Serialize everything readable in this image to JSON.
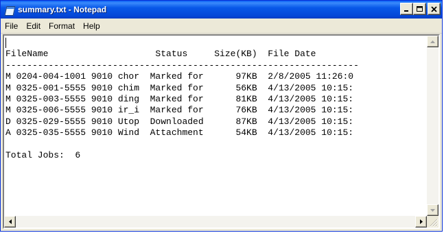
{
  "window": {
    "title": "summary.txt - Notepad",
    "app_icon": "notepad-icon",
    "controls": [
      "minimize-icon",
      "maximize-icon",
      "close-icon"
    ]
  },
  "menu": [
    {
      "label": "File"
    },
    {
      "label": "Edit"
    },
    {
      "label": "Format"
    },
    {
      "label": "Help"
    }
  ],
  "document": {
    "lines": [
      "",
      "FileName                    Status     Size(KB)  File Date",
      "------------------------------------------------------------------",
      "M 0204-004-1001 9010 chor  Marked for      97KB  2/8/2005 11:26:0",
      "M 0325-001-5555 9010 chim  Marked for      56KB  4/13/2005 10:15:",
      "M 0325-003-5555 9010 ding  Marked for      81KB  4/13/2005 10:15:",
      "M 0325-006-5555 9010 ir_i  Marked for      76KB  4/13/2005 10:15:",
      "D 0325-029-5555 9010 Utop  Downloaded      87KB  4/13/2005 10:15:",
      "A 0325-035-5555 9010 Wind  Attachment      54KB  4/13/2005 10:15:",
      "",
      "Total Jobs:  6"
    ]
  },
  "scrollbars": {
    "vertical": [
      "scroll-up-arrow-icon",
      "scroll-down-arrow-icon"
    ],
    "horizontal": [
      "scroll-left-arrow-icon",
      "scroll-right-arrow-icon"
    ]
  }
}
